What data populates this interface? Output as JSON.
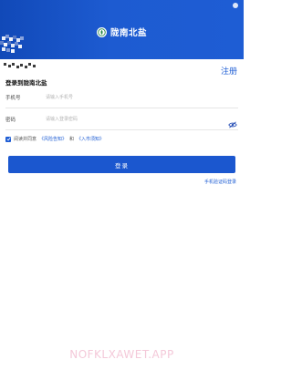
{
  "header": {
    "app_title": "陇南北盐",
    "brand_color": "#1e5dd4",
    "logo_icon": "wheat-leaf-logo-icon"
  },
  "auth": {
    "register_label": "注册",
    "heading": "登录到陇南北盐"
  },
  "form": {
    "phone": {
      "label": "手机号",
      "placeholder": "请输入手机号",
      "value": ""
    },
    "password": {
      "label": "密码",
      "placeholder": "请输入登录密码",
      "value": "",
      "toggle_icon": "eye-off-icon"
    }
  },
  "agreement": {
    "checked": true,
    "prefix": "阅读并同意",
    "risk_notice": "《风险告知》",
    "and": "和",
    "entry_notice": "《入市须知》"
  },
  "actions": {
    "login_label": "登录",
    "sms_login_label": "手机验证码登录"
  },
  "watermark": {
    "text": "NOFKLXAWET.APP"
  }
}
